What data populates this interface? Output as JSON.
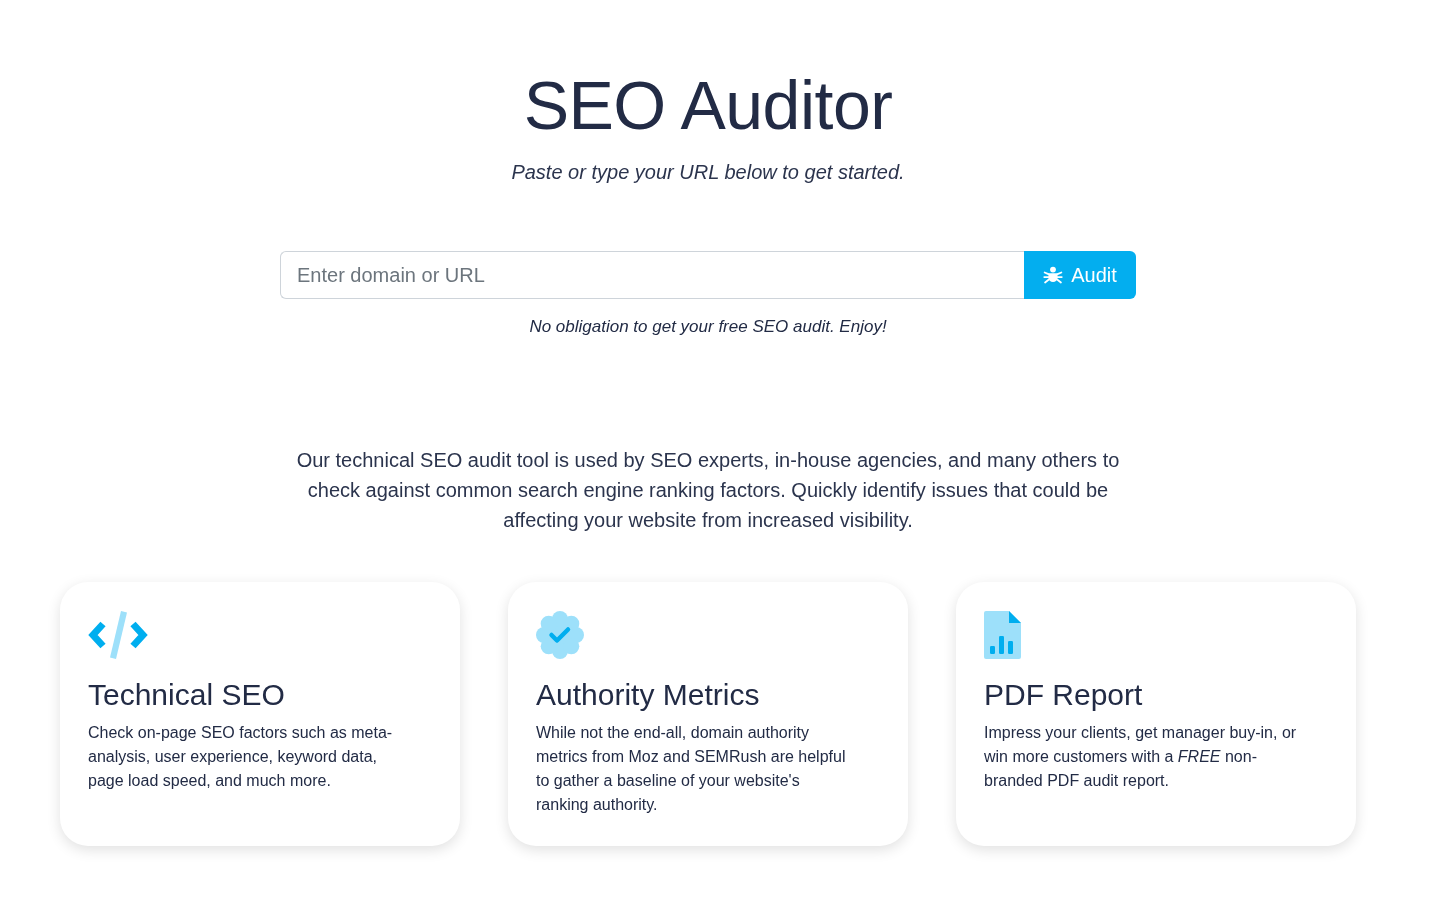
{
  "header": {
    "title": "SEO Auditor",
    "subtitle": "Paste or type your URL below to get started."
  },
  "search": {
    "placeholder": "Enter domain or URL",
    "button": "Audit",
    "note": "No obligation to get your free SEO audit. Enjoy!"
  },
  "intro": "Our technical SEO audit tool is used by SEO experts, in-house agencies, and many others to check against common search engine ranking factors. Quickly identify issues that could be affecting your website from increased visibility.",
  "features": [
    {
      "kind": "code",
      "title": "Technical SEO",
      "text": "Check on-page SEO factors such as meta-analysis, user experience, keyword data, page load speed, and much more."
    },
    {
      "kind": "badge",
      "title": "Authority Metrics",
      "text": "While not the end-all, domain authority metrics from Moz and SEMRush are helpful to gather a baseline of your website's ranking authority."
    },
    {
      "kind": "report",
      "title": "PDF Report",
      "text": "Impress your clients, get manager buy-in, or win more customers with a *FREE* non-branded PDF audit report."
    }
  ]
}
